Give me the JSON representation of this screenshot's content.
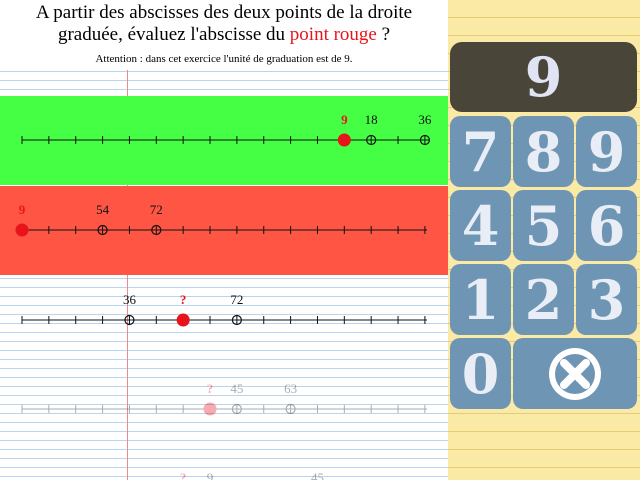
{
  "question": {
    "line1": "A partir des abscisses des deux points de la droite",
    "line2_before": "graduée, évaluez l'abscisse du ",
    "line2_highlight": "point rouge",
    "line2_after": " ?",
    "note": "Attention : dans cet exercice l'unité de graduation est de 9."
  },
  "colors": {
    "correct_band": "#44ff44",
    "wrong_band": "#ff5544",
    "red_point": "#e8141b",
    "keypad_bg": "#fbe9a6",
    "key": "#6f95b5",
    "display": "#4a4539"
  },
  "number_lines": [
    {
      "status": "correct",
      "opacity": 1,
      "labels": [
        {
          "text": "9",
          "tick": 12,
          "red": true
        },
        {
          "text": "18",
          "tick": 13,
          "red": false
        },
        {
          "text": "36",
          "tick": 15,
          "red": false
        }
      ],
      "points": [
        {
          "tick": 12,
          "type": "red"
        },
        {
          "tick": 13,
          "type": "open"
        },
        {
          "tick": 15,
          "type": "open"
        }
      ]
    },
    {
      "status": "wrong",
      "opacity": 1,
      "labels": [
        {
          "text": "9",
          "tick": 0,
          "red": true
        },
        {
          "text": "54",
          "tick": 3,
          "red": false
        },
        {
          "text": "72",
          "tick": 5,
          "red": false
        }
      ],
      "points": [
        {
          "tick": 0,
          "type": "red"
        },
        {
          "tick": 3,
          "type": "open"
        },
        {
          "tick": 5,
          "type": "open"
        }
      ]
    },
    {
      "status": "current",
      "opacity": 1,
      "labels": [
        {
          "text": "36",
          "tick": 4,
          "red": false
        },
        {
          "text": "?",
          "tick": 6,
          "red": true
        },
        {
          "text": "72",
          "tick": 8,
          "red": false
        }
      ],
      "points": [
        {
          "tick": 4,
          "type": "open"
        },
        {
          "tick": 6,
          "type": "red"
        },
        {
          "tick": 8,
          "type": "open"
        }
      ]
    },
    {
      "status": "upcoming",
      "opacity": 0.35,
      "labels": [
        {
          "text": "?",
          "tick": 7,
          "red": true
        },
        {
          "text": "45",
          "tick": 8,
          "red": false
        },
        {
          "text": "63",
          "tick": 10,
          "red": false
        }
      ],
      "points": [
        {
          "tick": 7,
          "type": "red"
        },
        {
          "tick": 8,
          "type": "open"
        },
        {
          "tick": 10,
          "type": "open"
        }
      ]
    },
    {
      "status": "upcoming",
      "opacity": 0.35,
      "labels": [
        {
          "text": "?",
          "tick": 6,
          "red": true
        },
        {
          "text": "9",
          "tick": 7,
          "red": false
        },
        {
          "text": "45",
          "tick": 11,
          "red": false
        }
      ],
      "points": []
    }
  ],
  "keypad": {
    "display_value": "9",
    "keys": [
      "7",
      "8",
      "9",
      "4",
      "5",
      "6",
      "1",
      "2",
      "3",
      "0"
    ],
    "erase_icon": "close-circle-icon"
  }
}
